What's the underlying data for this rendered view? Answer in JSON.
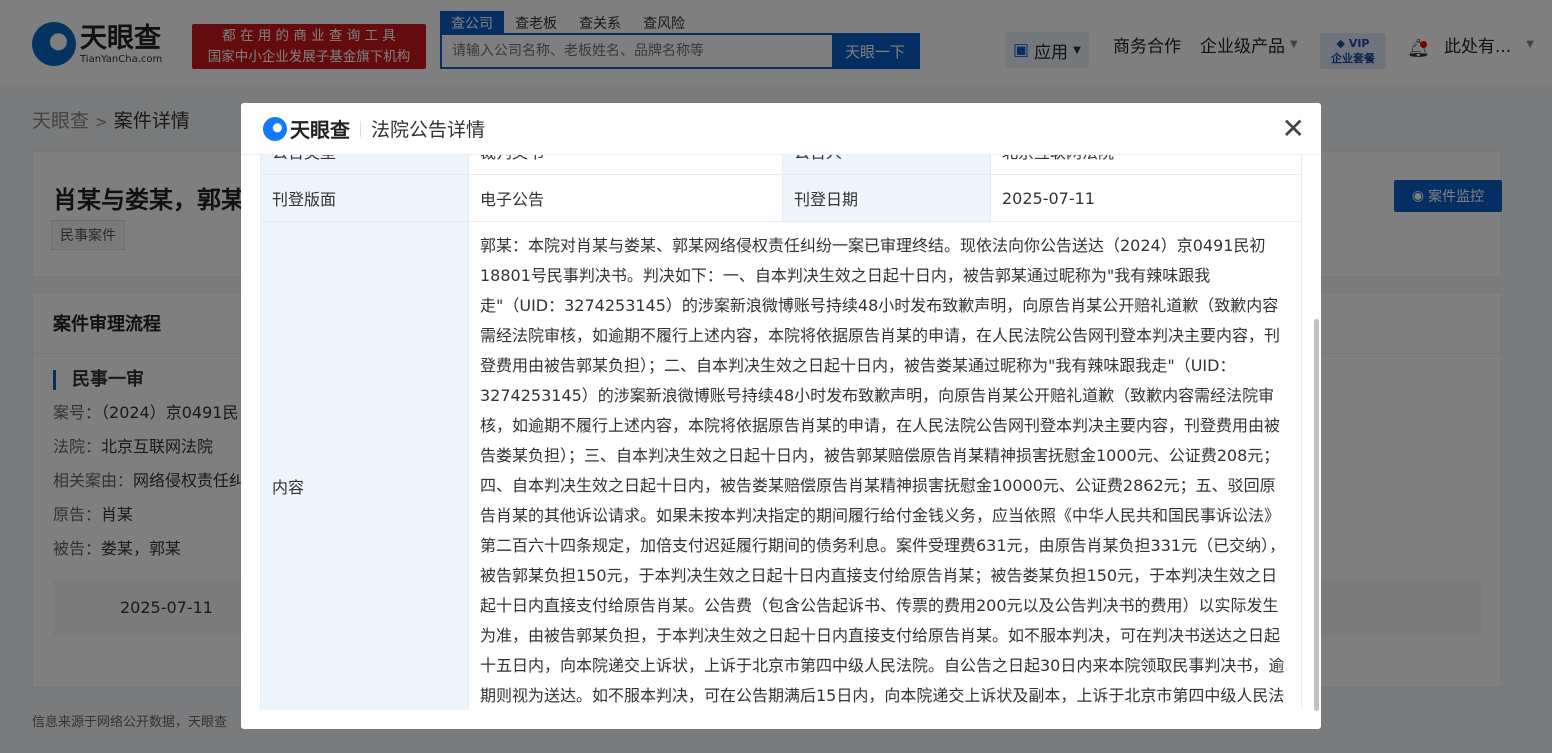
{
  "header": {
    "logo_text": "天眼查",
    "logo_domain": "TianYanCha.com",
    "slogan_line1": "都 在 用 的 商 业 查 询 工 具",
    "slogan_line2": "国家中小企业发展子基金旗下机构",
    "search_tabs": [
      "查公司",
      "查老板",
      "查关系",
      "查风险"
    ],
    "search_placeholder": "请输入公司名称、老板姓名、品牌名称等",
    "search_button": "天眼一下",
    "nav": {
      "apps": "应用",
      "business": "商务合作",
      "enterprise": "企业级产品",
      "vip_top": "VIP",
      "vip_bottom": "企业套餐",
      "user": "此处有..."
    }
  },
  "breadcrumb": {
    "home": "天眼查",
    "separator": ">",
    "current": "案件详情"
  },
  "case": {
    "title": "肖某与娄某，郭某",
    "tag": "民事案件",
    "monitor_button": "案件监控"
  },
  "process": {
    "title": "案件审理流程",
    "stage": "民事一审",
    "fields": [
      {
        "k": "案号：",
        "v": "（2024）京0491民"
      },
      {
        "k": "法院：",
        "v": "北京互联网法院"
      },
      {
        "k": "相关案由：",
        "v": "网络侵权责任纠"
      },
      {
        "k": "原告：",
        "v": "肖某"
      },
      {
        "k": "被告：",
        "v": "娄某，郭某"
      }
    ],
    "timeline_date": "2025-07-11"
  },
  "footer": "信息来源于网络公开数据，天眼查",
  "modal": {
    "logo_text": "天眼查",
    "title": "法院公告详情",
    "rows": {
      "type_label": "公告类型",
      "type_value": "裁判文书",
      "announcer_label": "公告人",
      "announcer_value": "北京互联网法院",
      "section_label": "刊登版面",
      "section_value": "电子公告",
      "date_label": "刊登日期",
      "date_value": "2025-07-11",
      "content_label": "内容",
      "content_value": "郭某：本院对肖某与娄某、郭某网络侵权责任纠纷一案已审理终结。现依法向你公告送达（2024）京0491民初18801号民事判决书。判决如下：一、自本判决生效之日起十日内，被告郭某通过昵称为\"我有辣味跟我走\"（UID：3274253145）的涉案新浪微博账号持续48小时发布致歉声明，向原告肖某公开赔礼道歉（致歉内容需经法院审核，如逾期不履行上述内容，本院将依据原告肖某的申请，在人民法院公告网刊登本判决主要内容，刊登费用由被告郭某负担）；二、自本判决生效之日起十日内，被告娄某通过昵称为\"我有辣味跟我走\"（UID：3274253145）的涉案新浪微博账号持续48小时发布致歉声明，向原告肖某公开赔礼道歉（致歉内容需经法院审核，如逾期不履行上述内容，本院将依据原告肖某的申请，在人民法院公告网刊登本判决主要内容，刊登费用由被告娄某负担）；三、自本判决生效之日起十日内，被告郭某赔偿原告肖某精神损害抚慰金1000元、公证费208元；四、自本判决生效之日起十日内，被告娄某赔偿原告肖某精神损害抚慰金10000元、公证费2862元；五、驳回原告肖某的其他诉讼请求。如果未按本判决指定的期间履行给付金钱义务，应当依照《中华人民共和国民事诉讼法》第二百六十四条规定，加倍支付迟延履行期间的债务利息。案件受理费631元，由原告肖某负担331元（已交纳），被告郭某负担150元，于本判决生效之日起十日内直接支付给原告肖某；被告娄某负担150元，于本判决生效之日起十日内直接支付给原告肖某。公告费（包含公告起诉书、传票的费用200元以及公告判决书的费用）以实际发生为准，由被告郭某负担，于本判决生效之日起十日内直接支付给原告肖某。如不服本判决，可在判决书送达之日起十五日内，向本院递交上诉状，上诉于北京市第四中级人民法院。自公告之日起30日内来本院领取民事判决书，逾期则视为送达。如不服本判决，可在公告期满后15日内，向本院递交上诉状及副本，上诉于北京市第四中级人民法院。逾期未上诉的，本判决即发生法律效力。"
    }
  },
  "colors": {
    "brand": "#0a5ec4",
    "slogan_bg": "#c8191b",
    "label_bg": "#eef5fc"
  }
}
